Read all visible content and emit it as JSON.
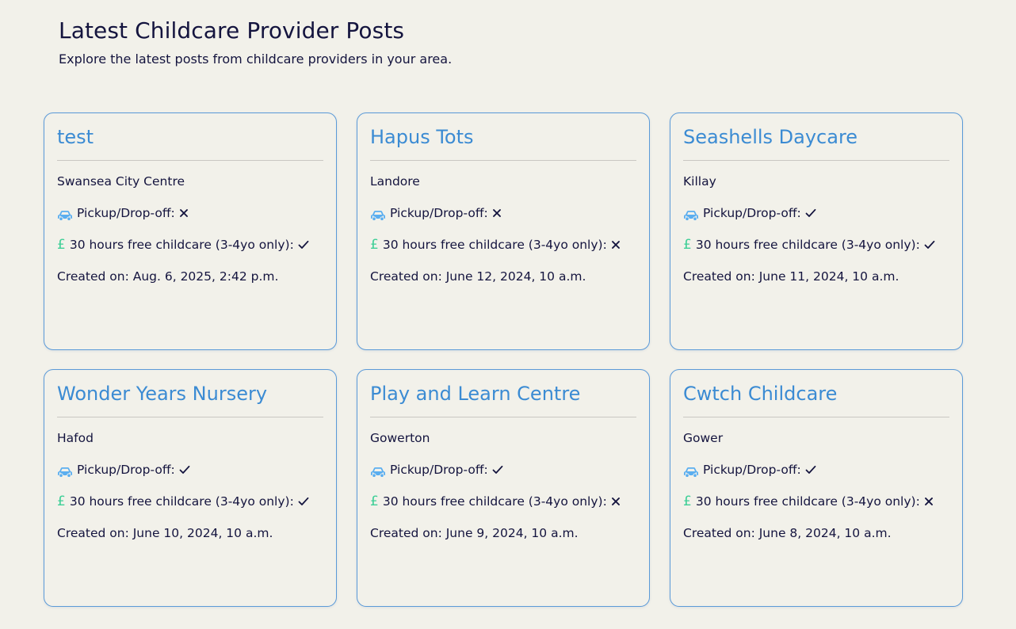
{
  "header": {
    "title": "Latest Childcare Provider Posts",
    "subtitle": "Explore the latest posts from childcare providers in your area."
  },
  "labels": {
    "pickup": "Pickup/Drop-off:",
    "free_hours": "30 hours free childcare (3-4yo only):",
    "created_prefix": "Created on: "
  },
  "colors": {
    "title": "#3b8bd3",
    "car_icon": "#5aaef0",
    "pound_icon": "#3fcf97",
    "border": "#5b9ad8"
  },
  "icons": {
    "pickup": "car-icon",
    "free_hours": "pound-icon",
    "yes": "check-icon",
    "no": "cross-icon"
  },
  "posts": [
    {
      "name": "test",
      "location": "Swansea City Centre",
      "pickup": false,
      "free_hours": true,
      "created": "Aug. 6, 2025, 2:42 p.m."
    },
    {
      "name": "Hapus Tots",
      "location": "Landore",
      "pickup": false,
      "free_hours": false,
      "created": "June 12, 2024, 10 a.m."
    },
    {
      "name": "Seashells Daycare",
      "location": "Killay",
      "pickup": true,
      "free_hours": true,
      "created": "June 11, 2024, 10 a.m."
    },
    {
      "name": "Wonder Years Nursery",
      "location": "Hafod",
      "pickup": true,
      "free_hours": true,
      "created": "June 10, 2024, 10 a.m."
    },
    {
      "name": "Play and Learn Centre",
      "location": "Gowerton",
      "pickup": true,
      "free_hours": false,
      "created": "June 9, 2024, 10 a.m."
    },
    {
      "name": "Cwtch Childcare",
      "location": "Gower",
      "pickup": true,
      "free_hours": false,
      "created": "June 8, 2024, 10 a.m."
    }
  ]
}
